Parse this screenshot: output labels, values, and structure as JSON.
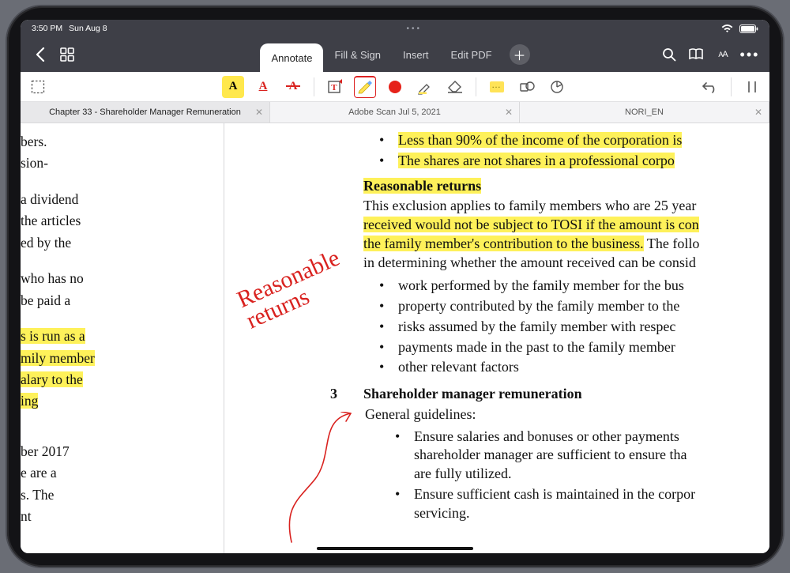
{
  "status": {
    "time": "3:50 PM",
    "date": "Sun Aug 8"
  },
  "top_tabs": {
    "annotate": "Annotate",
    "fillsign": "Fill & Sign",
    "insert": "Insert",
    "editpdf": "Edit PDF"
  },
  "doc_tabs": {
    "a": "Chapter 33 - Shareholder Manager Remuneration",
    "b": "Adobe Scan Jul 5, 2021",
    "c": "NORI_EN"
  },
  "left_page": {
    "l1": "bers.",
    "l2": "sion-",
    "l3": "a dividend",
    "l4": "the articles",
    "l5": "ed by the",
    "l6": "who has no",
    "l7": "be paid a",
    "l8": "s is run as a",
    "l9": "mily member",
    "l10": "alary to the",
    "l11": "ing",
    "l12": "ber 2017",
    "l13": "e are a",
    "l14": "s. The",
    "l15": "nt"
  },
  "right_page": {
    "b1": "Less than 90% of the income of the corporation is",
    "b2": "The shares are not shares in a professional corpo",
    "h1": "Reasonable returns",
    "p1a": "This exclusion applies to family members who are 25 year",
    "p1b": "received would not be subject to TOSI if the amount is con",
    "p1c": "the family member's contribution to the business.",
    "p1d": " The follo",
    "p1e": "in determining whether the amount received can be consid",
    "li1": "work performed by the family member for the bus",
    "li2": "property contributed by the family member to the",
    "li3": "risks assumed by the family member with respec",
    "li4": "payments made in the past to the family member",
    "li5": "other relevant factors",
    "secnum": "3",
    "h2": "Shareholder manager remuneration",
    "p2": "General guidelines:",
    "g1a": "Ensure salaries and bonuses or other payments ",
    "g1b": " shareholder manager are sufficient to ensure tha",
    "g1c": " are fully utilized.",
    "g2a": "Ensure sufficient cash is maintained in the corpor",
    "g2b": " servicing."
  },
  "handwriting": "Reasonable\nreturns"
}
